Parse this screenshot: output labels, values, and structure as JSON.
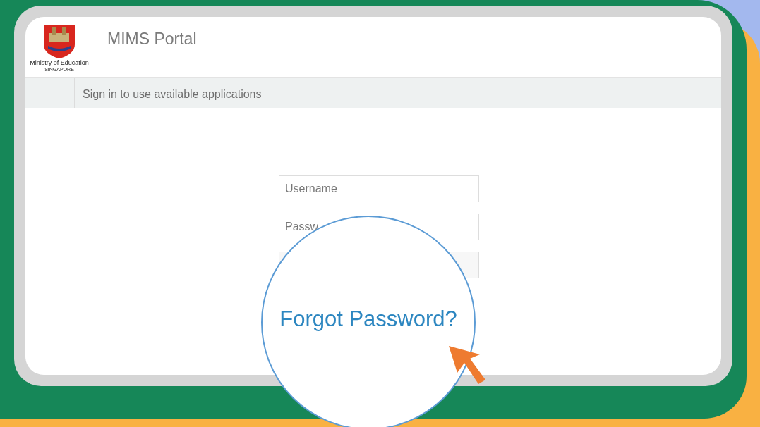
{
  "header": {
    "logo_caption": "Ministry of Education",
    "logo_subcaption": "SINGAPORE",
    "title": "MIMS Portal"
  },
  "subheader": {
    "text": "Sign in to use available applications"
  },
  "login": {
    "fields": [
      {
        "placeholder": "Username"
      },
      {
        "placeholder": "Passw"
      }
    ]
  },
  "magnifier": {
    "link": "Forgot Password?"
  }
}
